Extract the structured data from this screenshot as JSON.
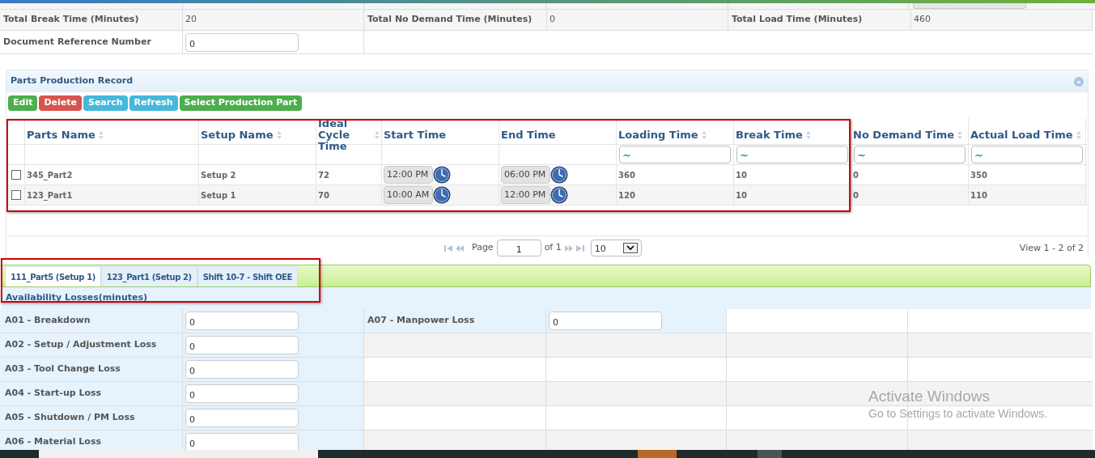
{
  "summary": {
    "rows": [
      {
        "cells": [
          {
            "label": "Total Break Time (Minutes)",
            "value": "20"
          },
          {
            "label": "Total No Demand Time (Minutes)",
            "value": "0"
          },
          {
            "label": "Total Load Time (Minutes)",
            "value": "460"
          }
        ]
      },
      {
        "cells": [
          {
            "label": "Document Reference Number",
            "field": "0"
          }
        ]
      }
    ]
  },
  "panel": {
    "title": "Parts Production Record",
    "expanded": true,
    "buttons": [
      {
        "label": "Edit",
        "kind": "success"
      },
      {
        "label": "Delete",
        "kind": "danger"
      },
      {
        "label": "Search",
        "kind": "info"
      },
      {
        "label": "Refresh",
        "kind": "info"
      },
      {
        "label": "Select Production Part",
        "kind": "success"
      }
    ],
    "grid": {
      "columns": [
        {
          "label": "Parts Name",
          "sortable": true
        },
        {
          "label": "Setup Name",
          "sortable": true
        },
        {
          "label": "Ideal Cycle Time",
          "sortable": true
        },
        {
          "label": "Start Time",
          "sortable": false
        },
        {
          "label": "End Time",
          "sortable": false
        },
        {
          "label": "Loading Time",
          "sortable": true,
          "filter": "~"
        },
        {
          "label": "Break Time",
          "sortable": true,
          "filter": "~"
        },
        {
          "label": "No Demand Time",
          "sortable": true,
          "filter": "~"
        },
        {
          "label": "Actual Load Time",
          "sortable": true,
          "filter": "~"
        }
      ],
      "rows": [
        {
          "checked": false,
          "cells": [
            "345_Part2",
            "Setup 2",
            "72",
            "12:00 PM",
            "06:00 PM",
            "360",
            "10",
            "0",
            "350"
          ]
        },
        {
          "checked": false,
          "cells": [
            "123_Part1",
            "Setup 1",
            "70",
            "10:00 AM",
            "12:00 PM",
            "120",
            "10",
            "0",
            "110"
          ]
        }
      ],
      "pager": {
        "page_label": "Page",
        "page": "1",
        "of": "of 1",
        "page_size": "10",
        "view": "View 1 - 2 of 2"
      }
    }
  },
  "tabs": [
    {
      "label": "111_Part5 (Setup 1)",
      "selected": true
    },
    {
      "label": "123_Part1 (Setup 2)",
      "selected": false
    },
    {
      "label": "Shift 10-7 - Shift OEE",
      "selected": false
    }
  ],
  "losses": {
    "title": "Availability Losses(minutes)",
    "rows": [
      {
        "left": {
          "label": "A01 - Breakdown",
          "value": "0"
        },
        "right": {
          "label": "A07 - Manpower Loss",
          "value": "0"
        }
      },
      {
        "left": {
          "label": "A02 - Setup / Adjustment Loss",
          "value": "0"
        }
      },
      {
        "left": {
          "label": "A03 - Tool Change Loss",
          "value": "0"
        }
      },
      {
        "left": {
          "label": "A04 - Start-up Loss",
          "value": "0"
        }
      },
      {
        "left": {
          "label": "A05 - Shutdown / PM Loss",
          "value": "0"
        }
      },
      {
        "left": {
          "label": "A06 - Material Loss",
          "value": "0"
        }
      }
    ]
  },
  "os_notice": {
    "title": "Activate Windows",
    "subtitle": "Go to Settings to activate Windows."
  }
}
